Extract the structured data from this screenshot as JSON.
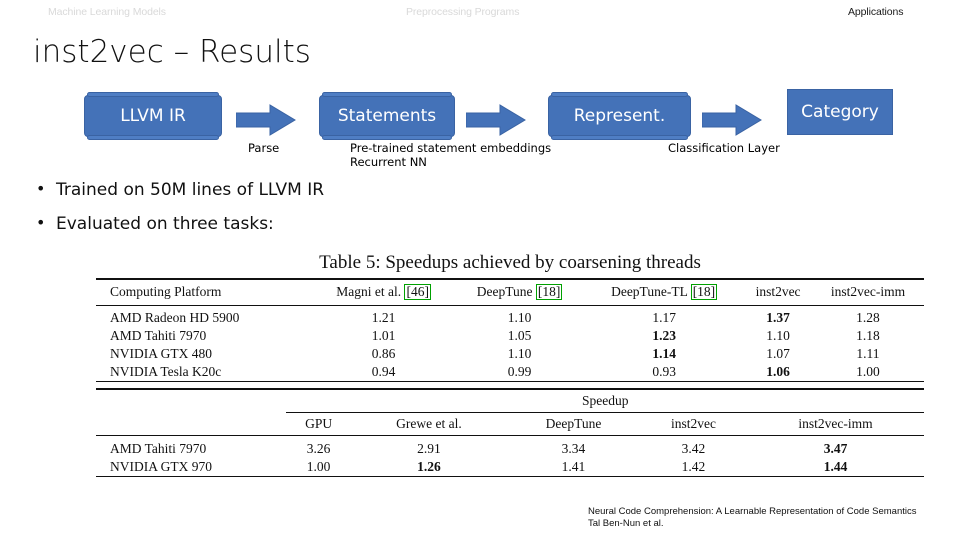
{
  "header": {
    "left_label": "Machine Learning Models",
    "center_label": "Preprocessing Programs",
    "right_label": "Applications"
  },
  "title": "inst2vec – Results",
  "flow": {
    "boxes": [
      {
        "label": "LLVM IR"
      },
      {
        "label": "Statements"
      },
      {
        "label": "Represent."
      },
      {
        "label": "Category"
      }
    ],
    "captions": [
      {
        "line1": "Parse",
        "line2": ""
      },
      {
        "line1": "Pre-trained statement embeddings",
        "line2": "Recurrent NN"
      },
      {
        "line1": "Classification Layer",
        "line2": ""
      }
    ],
    "box_color": "#4472B8",
    "arrow_color": "#4472B8"
  },
  "bullets": [
    "Trained on 50M lines of LLVM IR",
    "Evaluated on three tasks:"
  ],
  "table1": {
    "title": "Table 5: Speedups achieved by coarsening threads",
    "columns": [
      {
        "text": "Computing Platform",
        "cite": ""
      },
      {
        "text": "Magni et al.",
        "cite": "[46]"
      },
      {
        "text": "DeepTune",
        "cite": "[18]"
      },
      {
        "text": "DeepTune-TL",
        "cite": "[18]"
      },
      {
        "text": "inst2vec",
        "cite": ""
      },
      {
        "text": "inst2vec-imm",
        "cite": ""
      }
    ],
    "rows": [
      {
        "platform": "AMD Radeon HD 5900",
        "values": [
          "1.21",
          "1.10",
          "1.17",
          "1.37",
          "1.28"
        ],
        "bold": [
          false,
          false,
          false,
          true,
          false
        ]
      },
      {
        "platform": "AMD Tahiti 7970",
        "values": [
          "1.01",
          "1.05",
          "1.23",
          "1.10",
          "1.18"
        ],
        "bold": [
          false,
          false,
          true,
          false,
          false
        ]
      },
      {
        "platform": "NVIDIA GTX 480",
        "values": [
          "0.86",
          "1.10",
          "1.14",
          "1.07",
          "1.11"
        ],
        "bold": [
          false,
          false,
          true,
          false,
          false
        ]
      },
      {
        "platform": "NVIDIA Tesla K20c",
        "values": [
          "0.94",
          "0.99",
          "0.93",
          "1.06",
          "1.00"
        ],
        "bold": [
          false,
          false,
          false,
          true,
          false
        ]
      }
    ],
    "cite_border_color": "#00a000"
  },
  "table2": {
    "group_header": "Speedup",
    "columns": [
      "GPU",
      "Grewe et al.",
      "DeepTune",
      "inst2vec",
      "inst2vec-imm"
    ],
    "rows": [
      {
        "platform": "AMD Tahiti 7970",
        "values": [
          "3.26",
          "2.91",
          "3.34",
          "3.42",
          "3.47"
        ],
        "bold": [
          false,
          false,
          false,
          false,
          true
        ]
      },
      {
        "platform": "NVIDIA GTX 970",
        "values": [
          "1.00",
          "1.26",
          "1.41",
          "1.42",
          "1.44"
        ],
        "bold": [
          false,
          true,
          false,
          false,
          true
        ]
      }
    ]
  },
  "footer": {
    "line1": "Neural Code Comprehension: A Learnable Representation of Code Semantics",
    "line2": "Tal Ben-Nun et al."
  }
}
